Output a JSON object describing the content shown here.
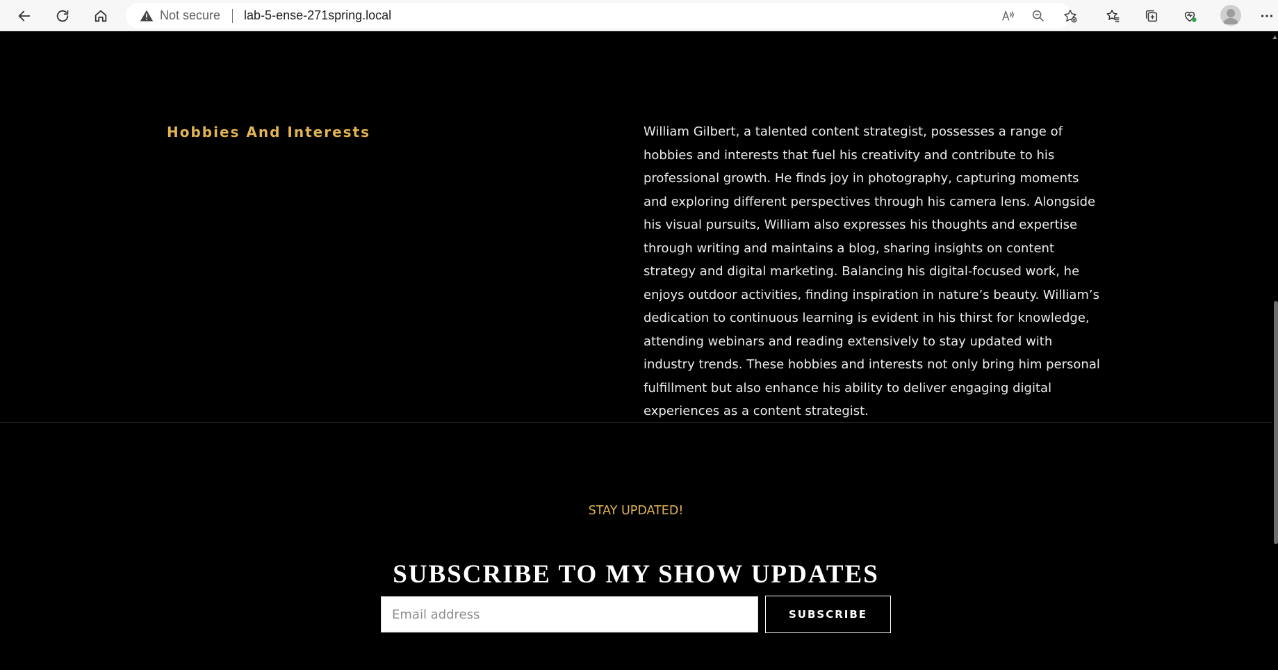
{
  "browser": {
    "security_label": "Not secure",
    "url": "lab-5-ense-271spring.local",
    "icons": {
      "back": "back-arrow-icon",
      "reload": "reload-icon",
      "home": "home-icon",
      "security": "warning-triangle-icon",
      "read_aloud": "read-aloud-icon",
      "zoom": "zoom-out-icon",
      "add_favorite": "add-favorite-icon",
      "favorites": "favorites-icon",
      "collections": "collections-icon",
      "browser_essentials": "browser-essentials-icon",
      "profile": "profile-avatar-icon",
      "menu": "more-menu-icon"
    }
  },
  "hobbies": {
    "title": "Hobbies And Interests",
    "text": "William Gilbert, a talented content strategist, possesses a range of hobbies and interests that fuel his creativity and contribute to his professional growth. He finds joy in photography, capturing moments and exploring different perspectives through his camera lens. Alongside his visual pursuits, William also expresses his thoughts and expertise through writing and maintains a blog, sharing insights on content strategy and digital marketing. Balancing his digital-focused work, he enjoys outdoor activities, finding inspiration in nature’s beauty. William’s dedication to continuous learning is evident in his thirst for knowledge, attending webinars and reading extensively to stay updated with industry trends. These hobbies and interests not only bring him personal fulfillment but also enhance his ability to deliver engaging digital experiences as a content strategist."
  },
  "newsletter": {
    "kicker": "STAY UPDATED!",
    "title": "SUBSCRIBE TO MY SHOW UPDATES",
    "email_placeholder": "Email address",
    "email_value": "",
    "button_label": "SUBSCRIBE"
  },
  "colors": {
    "accent_gold": "#e2b453",
    "background": "#000000",
    "text": "#ececec"
  }
}
